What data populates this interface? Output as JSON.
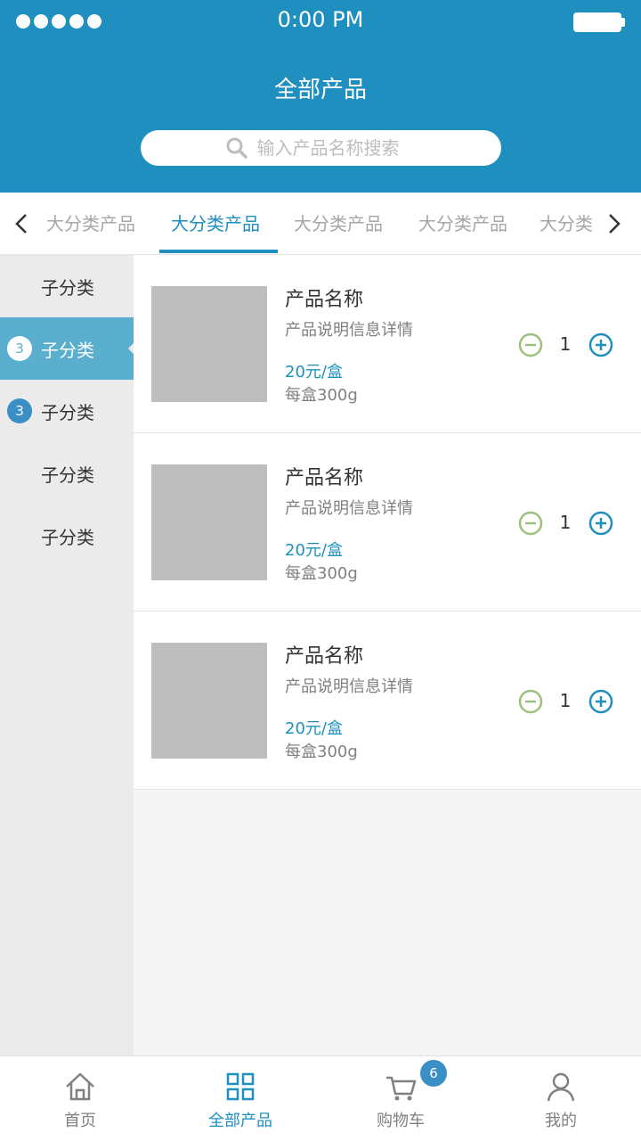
{
  "status_bar": {
    "time": "0:00 PM"
  },
  "header": {
    "title": "全部产品"
  },
  "search": {
    "placeholder": "输入产品名称搜索"
  },
  "category_tabs": [
    {
      "label": "大分类产品",
      "active": false
    },
    {
      "label": "大分类产品",
      "active": true
    },
    {
      "label": "大分类产品",
      "active": false
    },
    {
      "label": "大分类产品",
      "active": false
    },
    {
      "label": "大分类",
      "active": false
    }
  ],
  "sidebar": {
    "items": [
      {
        "label": "子分类",
        "badge": ""
      },
      {
        "label": "子分类",
        "badge": "3",
        "active": true
      },
      {
        "label": "子分类",
        "badge": "3"
      },
      {
        "label": "子分类",
        "badge": ""
      },
      {
        "label": "子分类",
        "badge": ""
      }
    ]
  },
  "products": [
    {
      "name": "产品名称",
      "desc": "产品说明信息详情",
      "price": "20元/盒",
      "spec": "每盒300g",
      "qty": "1"
    },
    {
      "name": "产品名称",
      "desc": "产品说明信息详情",
      "price": "20元/盒",
      "spec": "每盒300g",
      "qty": "1"
    },
    {
      "name": "产品名称",
      "desc": "产品说明信息详情",
      "price": "20元/盒",
      "spec": "每盒300g",
      "qty": "1"
    }
  ],
  "bottom_nav": {
    "items": [
      {
        "label": "首页",
        "icon": "home-icon"
      },
      {
        "label": "全部产品",
        "icon": "grid-icon",
        "active": true
      },
      {
        "label": "购物车",
        "icon": "cart-icon",
        "badge": "6"
      },
      {
        "label": "我的",
        "icon": "user-icon"
      }
    ]
  },
  "colors": {
    "header": "#1f8fc0",
    "sidebar_active": "#5aafce",
    "sidebar_bg": "#ebebeb",
    "page_bg": "#f5f5f5",
    "tab_text": "#a6a6a6",
    "price": "#1d91bc",
    "desc": "#808080",
    "minus": "#9dc07d"
  }
}
